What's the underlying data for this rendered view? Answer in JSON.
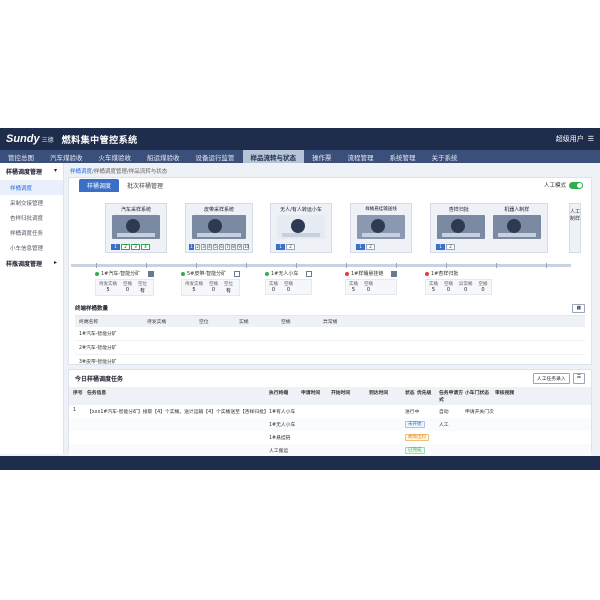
{
  "header": {
    "logo": "Sundy",
    "logo_cn": "三德",
    "title": "燃料集中管控系统",
    "user": "超级用户"
  },
  "nav": [
    "管控总图",
    "汽车煤验收",
    "火车煤验收",
    "船运煤验收",
    "设备运行监管",
    "样品流转与状态",
    "操作票",
    "流程管理",
    "系统管理",
    "关于系统"
  ],
  "sidebar": {
    "group1": "样桶调度管理",
    "items": [
      "样桶调度",
      "采制交接管理",
      "杏样归批调度",
      "样桶调度任务",
      "小车信息管理"
    ],
    "group2": "样瓶调度管理"
  },
  "breadcrumb": {
    "cur": "样桶调度",
    "rest": "/样桶调度管理/样品流转与状态"
  },
  "tabs": [
    "样桶调度",
    "批次样桶管理"
  ],
  "manual_mode": "人工模式",
  "stations": [
    {
      "title": "汽车采样系统",
      "slots": [
        "1",
        "2",
        "3",
        "4"
      ]
    },
    {
      "title": "皮带采样系统",
      "slots": [
        "1",
        "2",
        "3",
        "4",
        "5",
        "6",
        "7",
        "8",
        "9",
        "10"
      ]
    },
    {
      "title": "无人/有人转运小车",
      "slots": [
        "1",
        "2"
      ]
    },
    {
      "title": "样桶悬挂输送线",
      "slots": [
        "1",
        "2"
      ]
    },
    {
      "title": "杏样归批",
      "slots": [
        "1",
        "2"
      ]
    },
    {
      "title": "机器人制样",
      "slots": []
    }
  ],
  "vertical_manual": "人工制样",
  "cards": [
    {
      "name": "1#汽车-智能分矿",
      "color": "#2fae4f",
      "kv": [
        [
          "待发实桶",
          "5"
        ],
        [
          "空桶",
          "0"
        ],
        [
          "空位",
          "有"
        ]
      ]
    },
    {
      "name": "5#皮带-智能分矿",
      "color": "#2fae4f",
      "kv": [
        [
          "待发实桶",
          "5"
        ],
        [
          "空桶",
          "0"
        ],
        [
          "空位",
          "有"
        ]
      ]
    },
    {
      "name": "1#无人小车",
      "color": "#2fae4f",
      "kv": [
        [
          "实桶",
          "0"
        ],
        [
          "空桶",
          "0"
        ]
      ]
    },
    {
      "name": "1#样桶悬挂链",
      "color": "#e03c3c",
      "kv": [
        [
          "实桶",
          "5"
        ],
        [
          "空桶",
          "0"
        ]
      ]
    },
    {
      "name": "1#杏样归批",
      "color": "#e03c3c",
      "kv": [
        [
          "实桶",
          "5"
        ],
        [
          "空桶",
          "0"
        ],
        [
          "异常桶",
          "0"
        ],
        [
          "空桶",
          "0"
        ]
      ]
    }
  ],
  "terminal_table": {
    "title": "终端样桶数量",
    "headers": [
      "终端名称",
      "待发实桶",
      "空位",
      "实桶",
      "空桶",
      "异常桶",
      ""
    ],
    "rows": [
      "1#汽车-智能分矿",
      "2#汽车-智能分矿",
      "3#皮带-智能分矿"
    ]
  },
  "tasks": {
    "title": "今日样桶调度任务",
    "add_button": "人工任务录入",
    "headers": [
      "序号",
      "任务信息",
      "执行终端",
      "申请时间",
      "开始时间",
      "到达时间",
      "状态",
      "优先级",
      "任务申请方式",
      "小车门状态",
      "审核视频"
    ],
    "rows": [
      {
        "no": "1",
        "info": "【xxx1#汽车-智能分矿】接取【4】个实桶。送计运输【4】个实桶送至【杏样归批】",
        "terminal": "1#有人小车",
        "status": "进行中",
        "status_style": "",
        "mode": "自动",
        "door": "申请开关门次"
      },
      {
        "no": "",
        "info": "",
        "terminal": "1#无人小车",
        "status": "未开始",
        "status_style": "blue",
        "mode": "人工",
        "door": ""
      },
      {
        "no": "",
        "info": "",
        "terminal": "1#悬挂链",
        "status": "故障出料",
        "status_style": "orange",
        "mode": "",
        "door": ""
      },
      {
        "no": "",
        "info": "",
        "terminal": "人工搬运",
        "status": "已完成",
        "status_style": "green",
        "mode": "",
        "door": ""
      }
    ]
  }
}
